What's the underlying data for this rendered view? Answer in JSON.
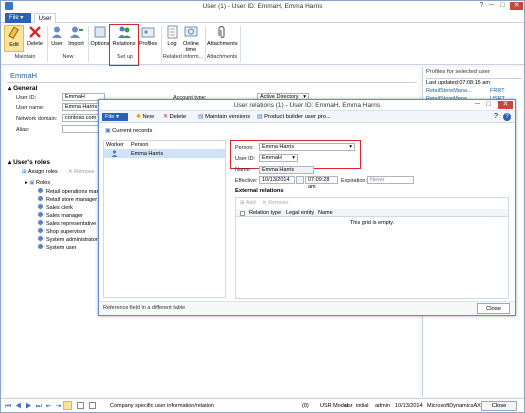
{
  "window": {
    "title": "User (1) - User ID: EmmaH, Emma Harris",
    "help": "?",
    "minimize": "─",
    "maximize": "□",
    "close": "✕"
  },
  "ribbon": {
    "file": "File",
    "tab_user": "User",
    "buttons": {
      "edit": "Edit",
      "delete": "Delete",
      "user": "User",
      "import": "Import",
      "options": "Options",
      "relations": "Relations",
      "profiles": "Profiles",
      "log": "Log",
      "online": "Online time",
      "attachments": "Attachments"
    },
    "groups": {
      "maintain": "Maintain",
      "new": "New",
      "setup": "Set up",
      "related": "Related inform...",
      "attachments": "Attachments"
    }
  },
  "main": {
    "user_heading": "EmmaH",
    "general": "General",
    "fields": {
      "user_id_label": "User ID:",
      "user_id": "EmmaH",
      "user_name_label": "User name:",
      "user_name": "Emma Harris",
      "network_domain_label": "Network domain:",
      "network_domain": "contoso.com",
      "alias_label": "Alias:",
      "alias": "",
      "account_type_label": "Account type:",
      "account_type": "Active Directory user"
    },
    "roles_title": "User's roles",
    "assign_roles": "Assign roles",
    "remove": "Remove",
    "roles_root": "Roles",
    "roles": [
      "Retail operations manager",
      "Retail store manager",
      "Sales clerk",
      "Sales manager",
      "Sales representative",
      "Shop supervisor",
      "System administrator",
      "System user"
    ]
  },
  "rpanel": {
    "title": "Profiles for selected user",
    "last_updated": "Last updated:07:08:15 am",
    "rows": [
      {
        "name": "RetailStoreMana...",
        "code": "FRRT"
      },
      {
        "name": "RetailStoreMana...",
        "code": "USRT"
      }
    ]
  },
  "dialog": {
    "title": "User relations (1) - User ID: EmmaH, Emma Harris",
    "toolbar": {
      "file": "File",
      "new": "New",
      "delete": "Delete",
      "maintain_versions": "Maintain versions",
      "product_builder": "Product builder user pro..."
    },
    "current_records": "Current records",
    "list": {
      "col_worker": "Worker",
      "col_person": "Person",
      "row_person": "Emma Harris"
    },
    "person_label": "Person:",
    "person_value": "Emma Harris",
    "user_id_label": "User ID:",
    "user_id_value": "EmmaH",
    "name_label": "Name:",
    "name_value": "Emma Harris",
    "effective_label": "Effective:",
    "effective_date": "10/13/2014",
    "effective_time": "07:09:28 am",
    "expiration_label": "Expiration:",
    "expiration_value": "Never",
    "external_relations": "External relations",
    "add": "Add",
    "remove": "Remove",
    "grid_cols": {
      "relation_type": "Relation type",
      "legal_entity": "Legal entity",
      "name": "Name"
    },
    "grid_empty": "This grid is empty.",
    "status": "Reference field in a different table",
    "close": "Close"
  },
  "status": {
    "text": "Company specific user information/relation",
    "count": "(0)",
    "model": "USR Model",
    "company": "usr",
    "layer": "initial",
    "user": "admin",
    "date": "10/13/2014",
    "app": "MicrosoftDynamicsAX",
    "close": "Close"
  },
  "colors": {
    "accent": "#2a62b6",
    "highlight": "#d9262c",
    "selection": "#cfe2f7"
  }
}
